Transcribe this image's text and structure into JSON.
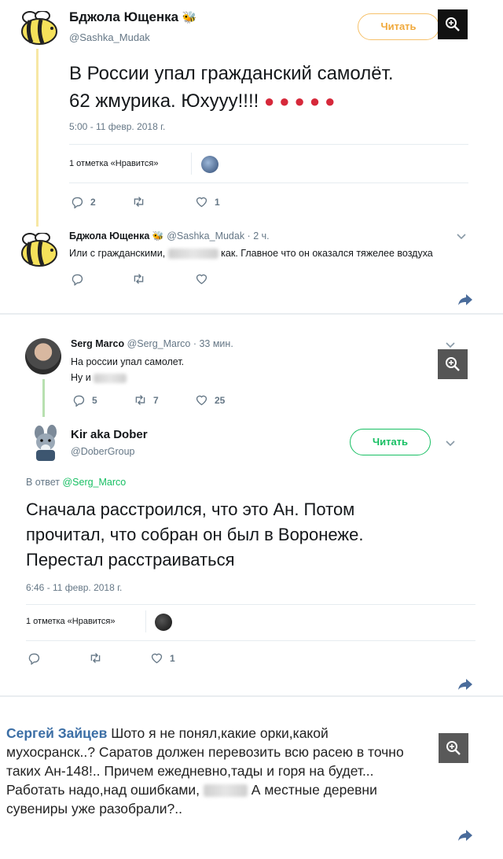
{
  "tweet1": {
    "author_name": "Бджола Ющенка",
    "author_handle": "@Sashka_Mudak",
    "follow_label": "Читать",
    "text_line1": "В России упал гражданский самолёт.",
    "text_line2": "62 жмурика. Юхууу!!!!",
    "timestamp": "5:00 - 11 февр. 2018 г.",
    "likes_summary": "1 отметка «Нравится»",
    "reply_count": "2",
    "like_count": "1"
  },
  "reply1": {
    "author_name": "Бджола Ющенка",
    "author_handle": "@Sashka_Mudak · 2 ч.",
    "text_prefix": "Или с гражданскими,",
    "text_suffix": "как. Главное что он оказался тяжелее воздуха"
  },
  "tweet2": {
    "author_name": "Serg Marco",
    "author_handle": "@Serg_Marco · 33 мин.",
    "text_line1": "На россии упал самолет.",
    "text_line2": "Ну и",
    "reply_count": "5",
    "retweet_count": "7",
    "like_count": "25"
  },
  "tweet3": {
    "author_name": "Kir aka Dober",
    "author_handle": "@DoberGroup",
    "follow_label": "Читать",
    "reply_prefix": "В ответ",
    "reply_to": "@Serg_Marco",
    "text_line1": "Сначала расстроился, что это Ан. Потом",
    "text_line2": "прочитал, что собран он был в Воронеже.",
    "text_line3": "Перестал расстраиваться",
    "timestamp": "6:46 - 11 февр. 2018 г.",
    "likes_summary": "1 отметка «Нравится»",
    "like_count": "1"
  },
  "comment": {
    "author_name": "Сергей Зайцев",
    "line1": "Шото я не понял,какие орки,какой",
    "line2": "мухосранск..? Саратов должен перевозить всю расею в точно",
    "line3": "таких Ан-148!.. Причем ежедневно,тады и горя на будет...",
    "line4_prefix": "Работать надо,над ошибками,",
    "line4_suffix": "А местные деревни",
    "line5": "сувениры уже разобрали?.."
  },
  "colors": {
    "bee_yellow": "#f5e15a",
    "twitter_blue": "#1da1f2",
    "green": "#17bf63",
    "follow_orange": "#f6c16a",
    "thread_yellow": "#f7e7a4",
    "thread_green": "#b8e0b0",
    "comment_name": "#3b6ea5"
  },
  "icons": [
    "zoom-icon",
    "reply-icon",
    "retweet-icon",
    "heart-icon",
    "share-icon",
    "chevron-down-icon",
    "balloon-emoji",
    "bee-emoji"
  ]
}
